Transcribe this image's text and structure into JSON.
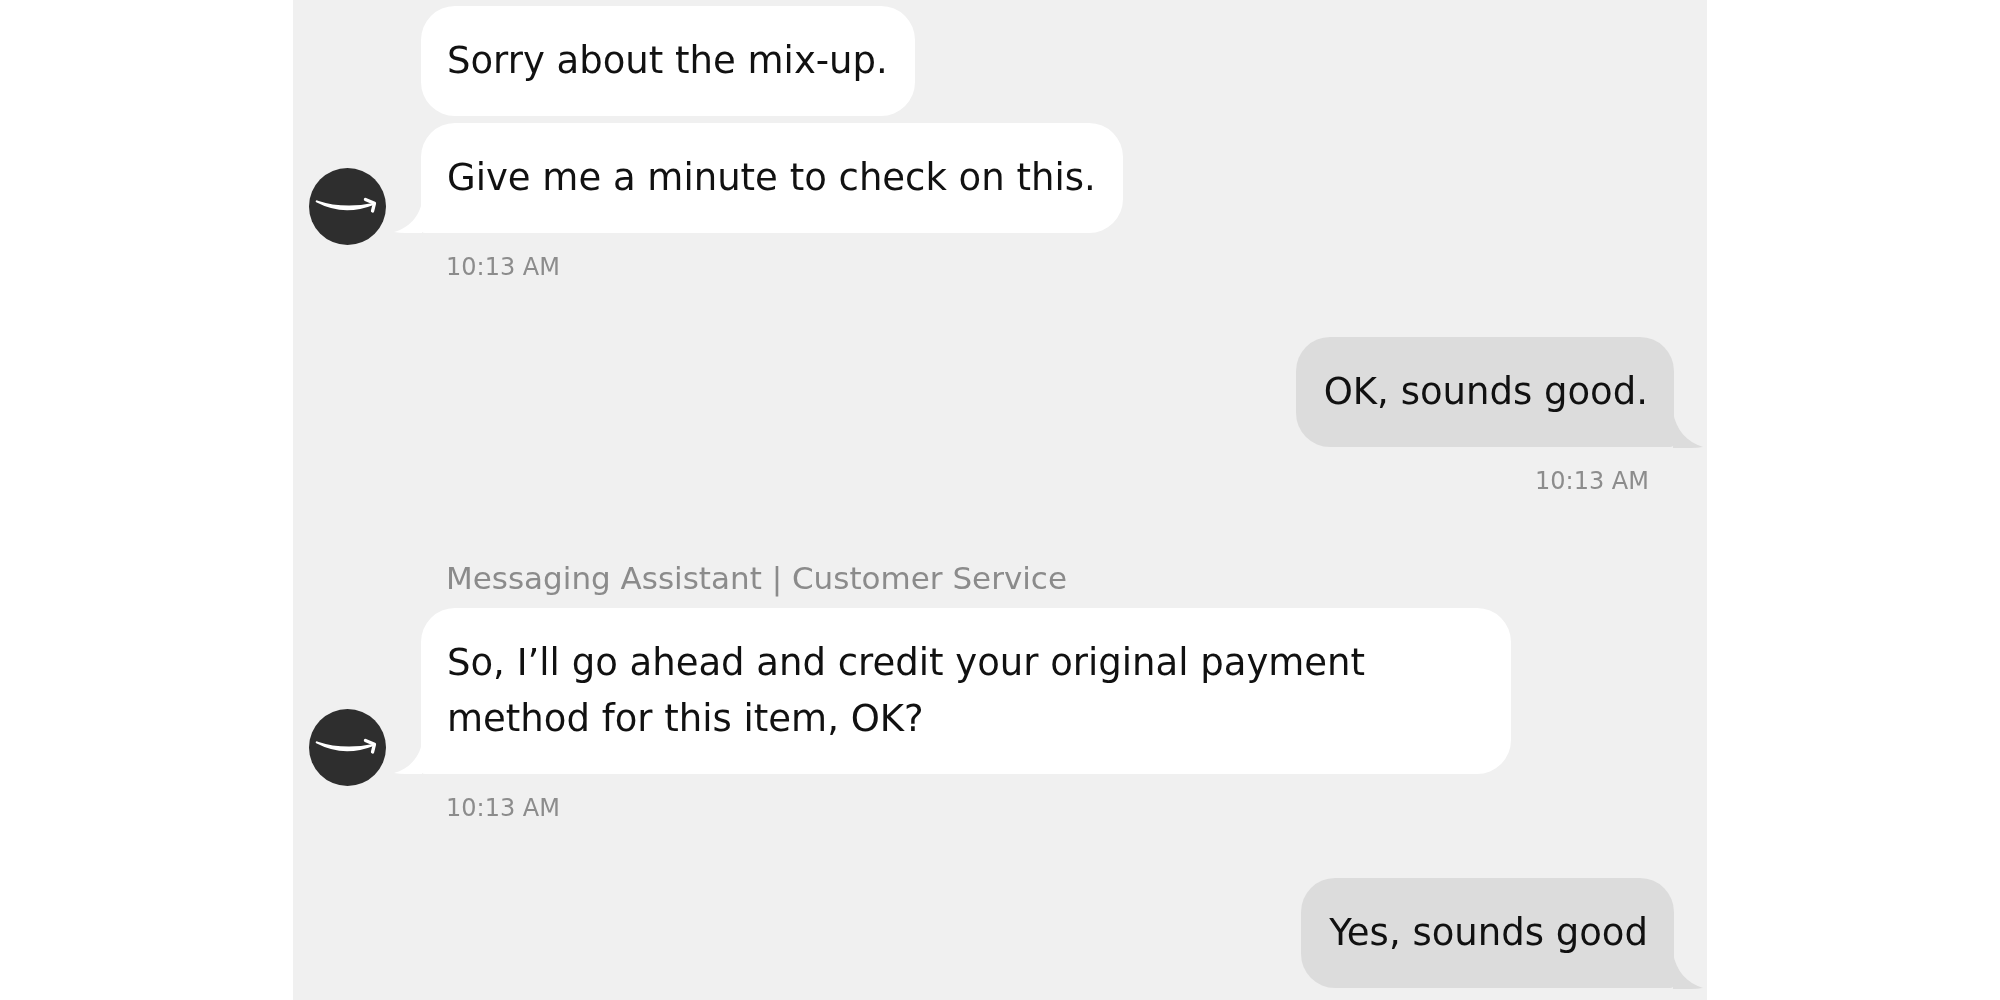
{
  "conversation": [
    {
      "kind": "agent",
      "bubbles": [
        "Sorry about the mix-up.",
        "Give me a minute to check on this."
      ],
      "time": "10:13 AM"
    },
    {
      "kind": "customer",
      "bubbles": [
        "OK, sounds good."
      ],
      "time": "10:13 AM"
    },
    {
      "kind": "agent",
      "sender": "Messaging Assistant | Customer Service",
      "bubbles": [
        "So, I’ll go ahead and credit your original payment method for this item, OK?"
      ],
      "time": "10:13 AM"
    },
    {
      "kind": "customer",
      "bubbles": [
        "Yes, sounds good"
      ]
    }
  ]
}
